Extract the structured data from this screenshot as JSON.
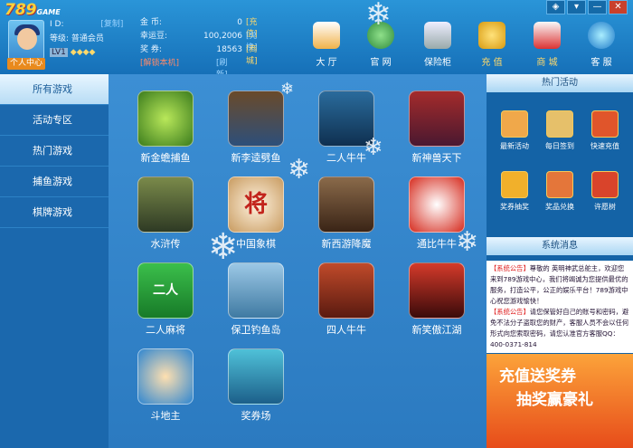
{
  "app": {
    "logo": "789",
    "logo_sub": "GAME",
    "personal_center": "个人中心"
  },
  "user": {
    "id_label": "I D:",
    "copy": "[复制]",
    "level_label": "等级:",
    "level_value": "普通会员",
    "lv": "LV1",
    "coins_label": "金 币:",
    "coins_value": "0",
    "recharge_link": "[充 值]",
    "lucky_label": "幸运豆:",
    "lucky_value": "100,2006",
    "exchange_link": "[兑 换]",
    "ticket_label": "奖 券:",
    "ticket_value": "18563",
    "mall_link": "[商 城]",
    "unlock": "[解锁本机]",
    "refresh": "[刷 新]"
  },
  "nav": [
    "大 厅",
    "官 网",
    "保险柜",
    "充 值",
    "商 城",
    "客 服"
  ],
  "window": {
    "skin": "◈",
    "menu": "▾",
    "minimize": "—",
    "close": "✕"
  },
  "sidebar": [
    "所有游戏",
    "活动专区",
    "热门游戏",
    "捕鱼游戏",
    "棋牌游戏"
  ],
  "games": [
    "新金蟾捕鱼",
    "新李逵劈鱼",
    "二人牛牛",
    "新神兽天下",
    "水浒传",
    "中国象棋",
    "新西游降魔",
    "通比牛牛",
    "二人麻将",
    "保卫钓鱼岛",
    "四人牛牛",
    "新笑傲江湖",
    "斗地主",
    "奖券场"
  ],
  "icons": {
    "chess": "将",
    "mahjong": "二人"
  },
  "hot": {
    "title": "热门活动",
    "items": [
      "最新活动",
      "每日签到",
      "快速充值",
      "奖券抽奖",
      "奖品兑换",
      "许愿树"
    ]
  },
  "msg": {
    "title": "系统消息",
    "tag": "【系统公告】",
    "text1": "尊敬的 英明神武总舵主，欢迎您来到789游戏中心，我们将竭诚为您提供最优的服务，打造公平，公正的娱乐平台！789游戏中心祝您游戏愉快！",
    "text2": "请您保管好自己的账号和密码，避免不法分子盗取您的财产，客服人员不会以任何形式向您索取密码，请您认准官方客服QQ：400-0371-814"
  },
  "promo": {
    "line1": "充值送奖券",
    "line2": "抽奖赢豪礼"
  },
  "colors": {
    "accent": "#ffd23a",
    "brand": "#1b68ad"
  }
}
